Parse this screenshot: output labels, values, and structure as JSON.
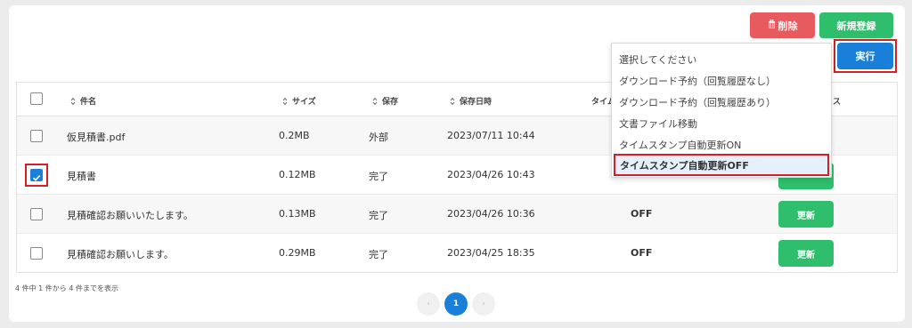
{
  "toolbar": {
    "delete_label": "削除",
    "new_label": "新規登録",
    "execute_label": "実行"
  },
  "columns": {
    "name": "件名",
    "size": "サイズ",
    "storage": "保存",
    "saved_at": "保存日時",
    "timestamp": "タイム",
    "status_suffix": "ス"
  },
  "rows": [
    {
      "name": "仮見積書.pdf",
      "size": "0.2MB",
      "storage": "外部",
      "saved_at": "2023/07/11 10:44",
      "checked": false
    },
    {
      "name": "見積書",
      "size": "0.12MB",
      "storage": "完了",
      "saved_at": "2023/04/26 10:43",
      "checked": true
    },
    {
      "name": "見積確認お願いいたします。",
      "size": "0.13MB",
      "storage": "完了",
      "saved_at": "2023/04/26 10:36",
      "timestamp": "OFF",
      "update_label": "更新",
      "checked": false
    },
    {
      "name": "見積確認お願いします。",
      "size": "0.29MB",
      "storage": "完了",
      "saved_at": "2023/04/25 18:35",
      "timestamp": "OFF",
      "update_label": "更新",
      "checked": false
    }
  ],
  "dropdown": {
    "options": [
      "選択してください",
      "ダウンロード予約（回覧履歴なし）",
      "ダウンロード予約（回覧履歴あり）",
      "文書ファイル移動",
      "タイムスタンプ自動更新ON",
      "タイムスタンプ自動更新OFF"
    ]
  },
  "pagination": {
    "summary": "4 件中 1 件から 4 件までを表示",
    "prev": "‹",
    "current": "1",
    "next": "›"
  },
  "colors": {
    "primary": "#1a7fd8",
    "success": "#2ebe6c",
    "danger": "#e75a5e",
    "highlight": "#d81d26"
  },
  "icons": [
    "trash-icon",
    "sort-icon",
    "check-icon",
    "chevron-left-icon",
    "chevron-right-icon"
  ]
}
